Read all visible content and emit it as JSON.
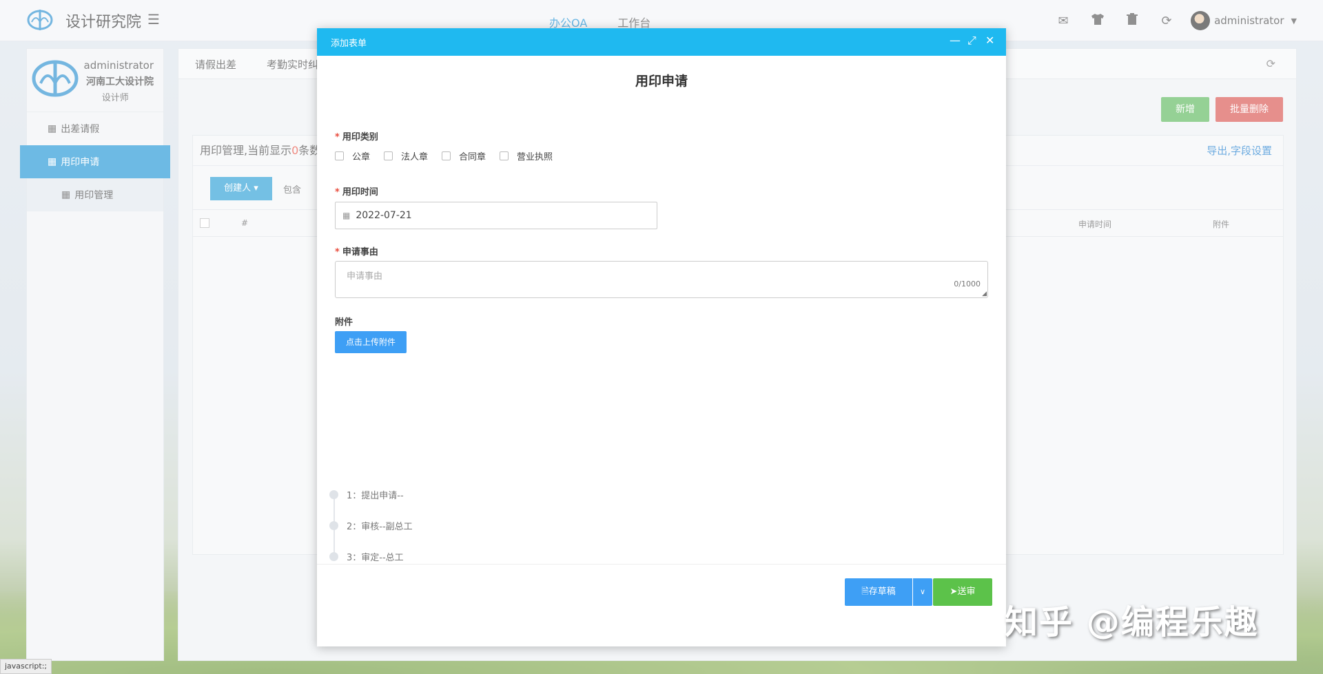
{
  "header": {
    "app_title": "设计研究院",
    "nav": [
      {
        "label": "办公OA",
        "active": true
      },
      {
        "label": "工作台",
        "active": false
      }
    ],
    "icons": [
      "mail-icon",
      "shirt-icon",
      "trash-icon",
      "refresh-icon"
    ],
    "user": "administrator"
  },
  "sidebar": {
    "profile": {
      "name": "administrator",
      "org": "河南工大设计院",
      "role": "设计师"
    },
    "items": [
      {
        "label": "出差请假",
        "active": false
      },
      {
        "label": "用印申请",
        "active": true
      },
      {
        "label": "用印管理",
        "sub": true
      }
    ]
  },
  "main": {
    "tabs": [
      "请假出差",
      "考勤实时纠"
    ],
    "add_label": "新增",
    "batch_delete_label": "批量删除",
    "panel_title_prefix": "用印管理,当前显示",
    "panel_count": "0",
    "panel_title_suffix": "条数",
    "export_label": "导出,字段设置",
    "creator_label": "创建人",
    "contains_label": "包含",
    "columns": [
      "#",
      "申请时间",
      "附件"
    ]
  },
  "modal": {
    "title": "添加表单",
    "form_title": "用印申请",
    "seal_type_label": "用印类别",
    "seal_options": [
      "公章",
      "法人章",
      "合同章",
      "营业执照"
    ],
    "time_label": "用印时间",
    "time_value": "2022-07-21",
    "reason_label": "申请事由",
    "reason_placeholder": "申请事由",
    "reason_count": "0/1000",
    "attach_label": "附件",
    "upload_label": "点击上传附件",
    "steps": [
      "1：提出申请--",
      "2：审核--副总工",
      "3：审定--总工"
    ],
    "draft_label": "存草稿",
    "send_label": "送审"
  },
  "watermark": "知乎 @编程乐趣",
  "status_url": "javascript:;",
  "colors": {
    "modal_header": "#1fb9f0",
    "primary": "#3e9ff5",
    "success": "#5cc24a",
    "danger": "#d9534f",
    "accent": "#1f95d6"
  }
}
